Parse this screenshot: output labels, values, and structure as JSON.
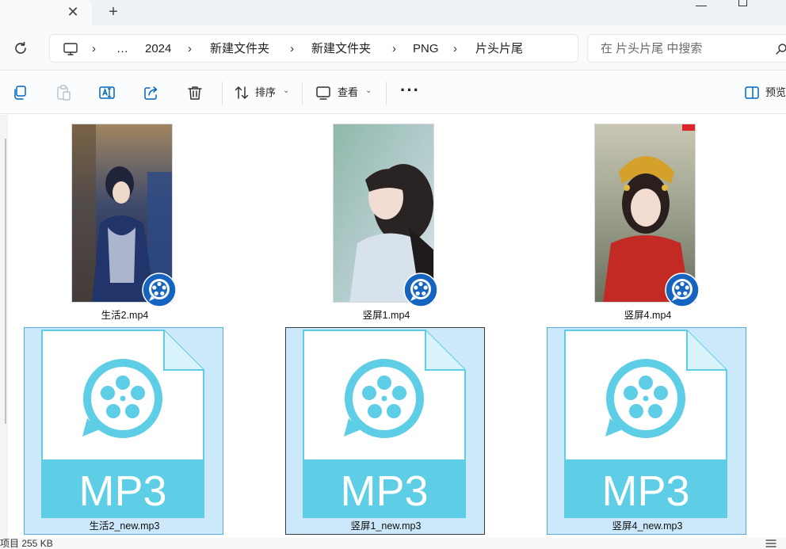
{
  "tabs": {
    "close_glyph": "✕",
    "new_glyph": "+"
  },
  "address": {
    "crumbs": [
      "…",
      "2024",
      "新建文件夹",
      "新建文件夹",
      "PNG",
      "片头片尾"
    ],
    "separator": "›"
  },
  "search": {
    "placeholder": "在 片头片尾 中搜索"
  },
  "toolbar": {
    "sort_label": "排序",
    "view_label": "查看",
    "more_label": "···",
    "preview_label": "预览"
  },
  "files": {
    "videos": [
      {
        "name": "生活2.mp4"
      },
      {
        "name": "竖屏1.mp4"
      },
      {
        "name": "竖屏4.mp4"
      }
    ],
    "audios": [
      {
        "name": "生活2_new.mp3",
        "type_label": "MP3"
      },
      {
        "name": "竖屏1_new.mp3",
        "type_label": "MP3"
      },
      {
        "name": "竖屏4_new.mp3",
        "type_label": "MP3"
      }
    ]
  },
  "status": {
    "text": "项目  255 KB"
  },
  "colors": {
    "accent": "#0067c0",
    "selection_bg": "#cce8fb",
    "mp3_cyan": "#5ecde6",
    "player_badge": "#1565c0"
  }
}
